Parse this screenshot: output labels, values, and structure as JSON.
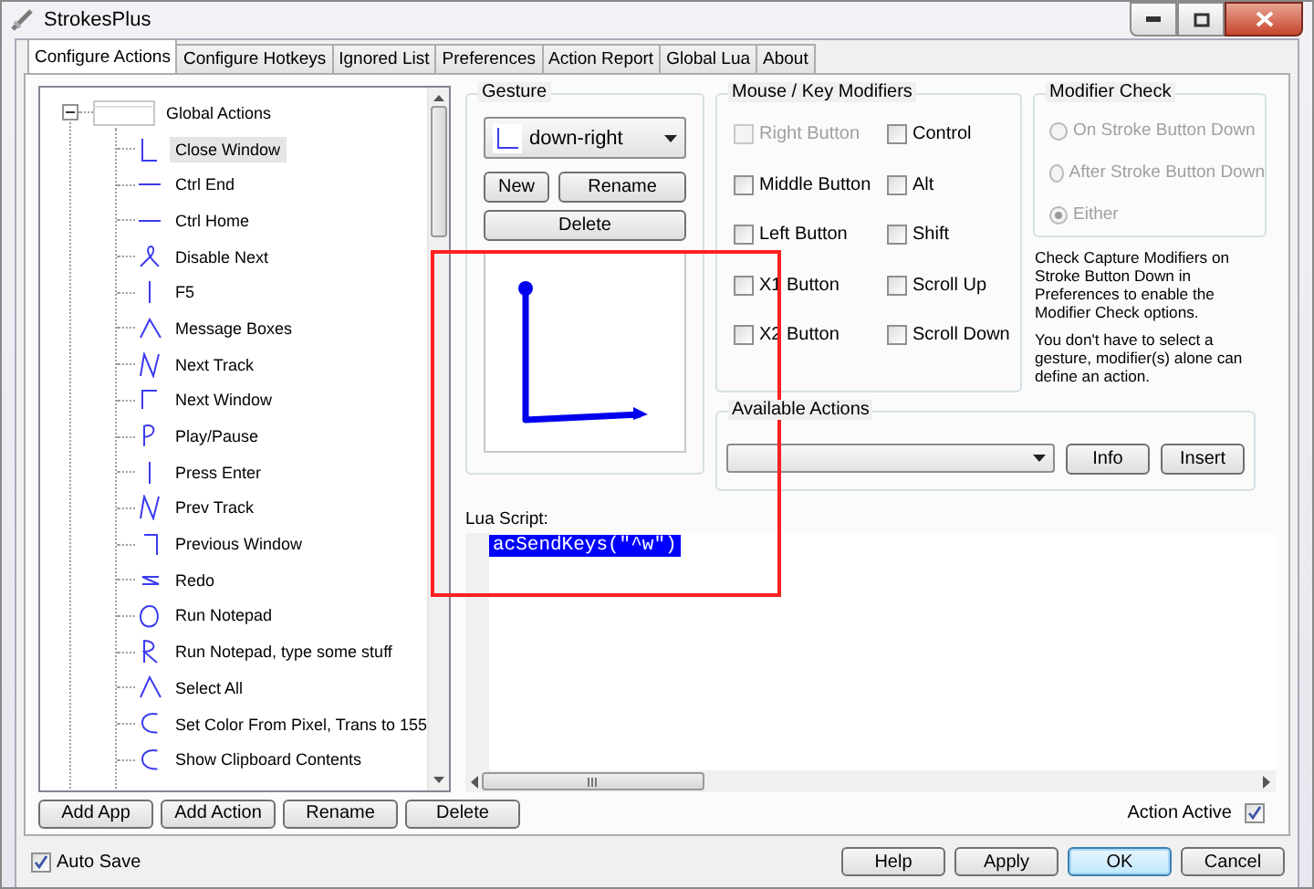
{
  "window": {
    "title": "StrokesPlus"
  },
  "tabs": [
    {
      "label": "Configure Actions",
      "selected": true
    },
    {
      "label": "Configure Hotkeys",
      "selected": false
    },
    {
      "label": "Ignored List",
      "selected": false
    },
    {
      "label": "Preferences",
      "selected": false
    },
    {
      "label": "Action Report",
      "selected": false
    },
    {
      "label": "Global Lua",
      "selected": false
    },
    {
      "label": "About",
      "selected": false
    }
  ],
  "tree": {
    "label": "Global Actions",
    "expanded": true,
    "children": [
      {
        "label": "Close Window",
        "selected": true
      },
      {
        "label": "Ctrl End",
        "selected": false
      },
      {
        "label": "Ctrl Home",
        "selected": false
      },
      {
        "label": "Disable Next",
        "selected": false
      },
      {
        "label": "F5",
        "selected": false
      },
      {
        "label": "Message Boxes",
        "selected": false
      },
      {
        "label": "Next Track",
        "selected": false
      },
      {
        "label": "Next Window",
        "selected": false
      },
      {
        "label": "Play/Pause",
        "selected": false
      },
      {
        "label": "Press Enter",
        "selected": false
      },
      {
        "label": "Prev Track",
        "selected": false
      },
      {
        "label": "Previous Window",
        "selected": false
      },
      {
        "label": "Redo",
        "selected": false
      },
      {
        "label": "Run Notepad",
        "selected": false
      },
      {
        "label": "Run Notepad, type some stuff",
        "selected": false
      },
      {
        "label": "Select All",
        "selected": false
      },
      {
        "label": "Set Color From Pixel, Trans to 155",
        "selected": false
      },
      {
        "label": "Show Clipboard Contents",
        "selected": false
      }
    ]
  },
  "tree_buttons": [
    "Add App",
    "Add Action",
    "Rename",
    "Delete"
  ],
  "gesture": {
    "title": "Gesture",
    "value": "down-right",
    "buttons": [
      "New",
      "Rename",
      "Delete"
    ]
  },
  "modifiers": {
    "title": "Mouse / Key Modifiers",
    "items": [
      {
        "label": "Right Button",
        "checked": false,
        "disabled": true
      },
      {
        "label": "Control",
        "checked": false,
        "disabled": false
      },
      {
        "label": "Middle Button",
        "checked": false,
        "disabled": false
      },
      {
        "label": "Alt",
        "checked": false,
        "disabled": false
      },
      {
        "label": "Left Button",
        "checked": false,
        "disabled": false
      },
      {
        "label": "Shift",
        "checked": false,
        "disabled": false
      },
      {
        "label": "X1 Button",
        "checked": false,
        "disabled": false
      },
      {
        "label": "Scroll Up",
        "checked": false,
        "disabled": false
      },
      {
        "label": "X2 Button",
        "checked": false,
        "disabled": false
      },
      {
        "label": "Scroll Down",
        "checked": false,
        "disabled": false
      }
    ]
  },
  "modifier_check": {
    "title": "Modifier Check",
    "options": [
      {
        "label": "On Stroke Button Down",
        "selected": false,
        "disabled": true
      },
      {
        "label": "After Stroke Button Down",
        "selected": false,
        "disabled": true
      },
      {
        "label": "Either",
        "selected": true,
        "disabled": true
      }
    ]
  },
  "notes": [
    "Check Capture Modifiers on Stroke Button Down in Preferences to enable the Modifier Check options.",
    "You don't have to select a gesture, modifier(s) alone can define an action."
  ],
  "available_actions": {
    "title": "Available Actions",
    "buttons": [
      "Info",
      "Insert"
    ]
  },
  "lua_script": {
    "label": "Lua Script:",
    "code": "acSendKeys(\"^w\")",
    "selected": true
  },
  "action_active": {
    "label": "Action Active",
    "checked": true
  },
  "auto_save": {
    "label": "Auto Save",
    "checked": true
  },
  "dialog_buttons": [
    {
      "label": "Help",
      "default": false
    },
    {
      "label": "Apply",
      "default": false
    },
    {
      "label": "OK",
      "default": true
    },
    {
      "label": "Cancel",
      "default": false
    }
  ]
}
